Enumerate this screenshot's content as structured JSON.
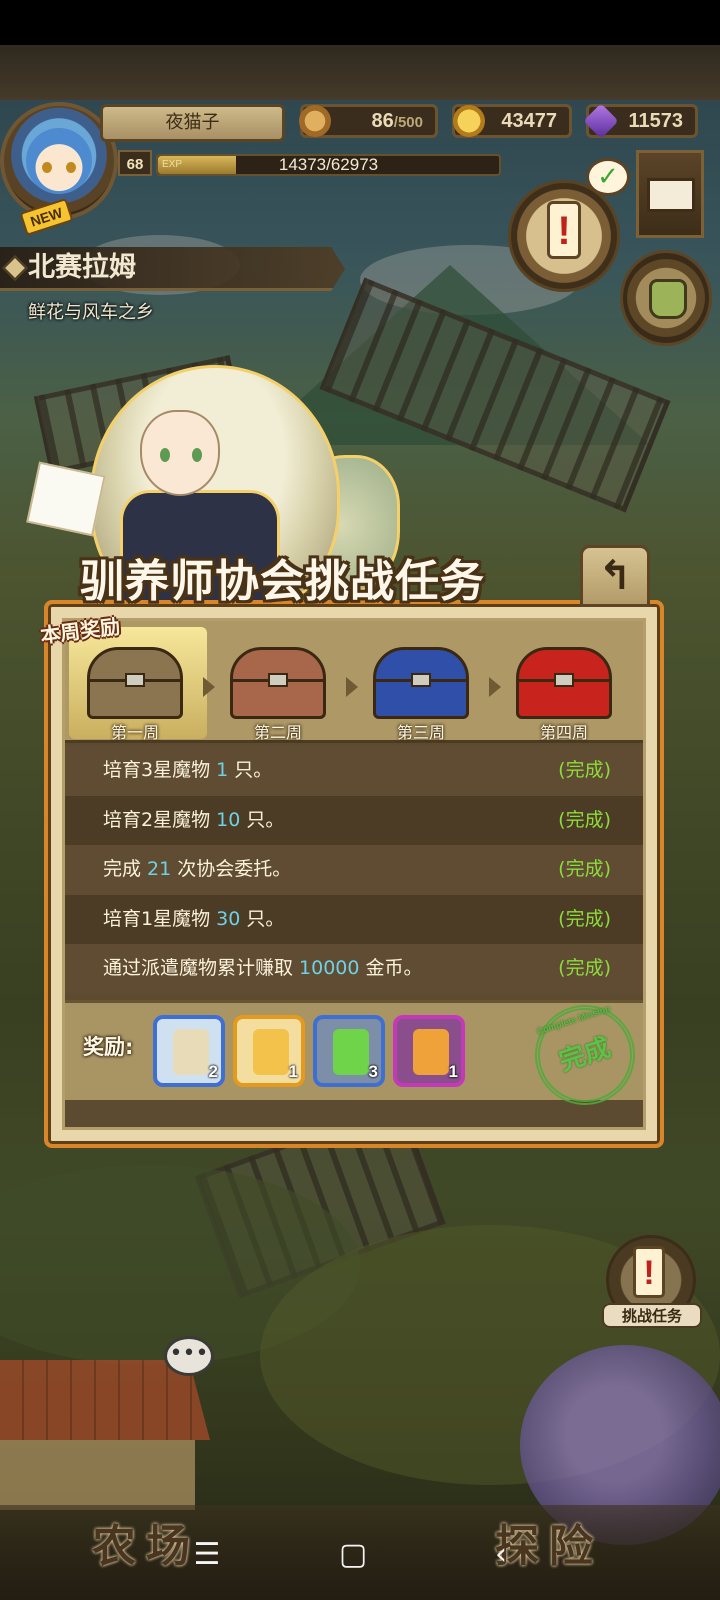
{
  "player": {
    "name": "夜猫子",
    "level": "68",
    "new_badge": "NEW",
    "exp_label": "EXP",
    "exp_text": "14373/62973",
    "exp_fraction": 0.228
  },
  "resources": {
    "stamina_value": "86",
    "stamina_max": "/500",
    "gold": "43477",
    "gems": "11573"
  },
  "location": {
    "title": "北赛拉姆",
    "subtitle": "鲜花与风车之乡"
  },
  "quest": {
    "title": "驯养师协会挑战任务",
    "back_icon": "return-arrow-icon",
    "back_glyph": "↰",
    "week_banner": "本周奖励",
    "weeks": [
      {
        "label": "第一周",
        "chest_color": "#8a7550"
      },
      {
        "label": "第二周",
        "chest_color": "#a8674a"
      },
      {
        "label": "第三周",
        "chest_color": "#2f4fa8"
      },
      {
        "label": "第四周",
        "chest_color": "#c8231c"
      }
    ],
    "tasks": [
      {
        "pre": "培育3星魔物 ",
        "num": "1",
        "post": " 只。",
        "status": "(完成)"
      },
      {
        "pre": "培育2星魔物 ",
        "num": "10",
        "post": " 只。",
        "status": "(完成)"
      },
      {
        "pre": "完成 ",
        "num": "21",
        "post": " 次协会委托。",
        "status": "(完成)"
      },
      {
        "pre": "培育1星魔物 ",
        "num": "30",
        "post": " 只。",
        "status": "(完成)"
      },
      {
        "pre": "通过派遣魔物累计赚取 ",
        "num": "10000",
        "post": " 金币。",
        "status": "(完成)"
      }
    ],
    "reward_label": "奖励:",
    "rewards": [
      {
        "icon": "scroll-icon",
        "count": "2",
        "border": "#3f6fd0",
        "bg": "#cfe0f0",
        "fill": "#e8dcb8"
      },
      {
        "icon": "potion-icon",
        "count": "1",
        "border": "#e39a1e",
        "bg": "#f3dea0",
        "fill": "#f2c24a"
      },
      {
        "icon": "green-tank-icon",
        "count": "3",
        "border": "#3f6fd0",
        "bg": "#7d8ea8",
        "fill": "#6fd44a"
      },
      {
        "icon": "rainbow-tank-icon",
        "count": "1",
        "border": "#c23ab8",
        "bg": "#8a4e8c",
        "fill": "#f0a23a"
      }
    ],
    "stamp_text": "完成",
    "stamp_ring": "Complete Mission"
  },
  "side": {
    "challenge_label": "挑战任务",
    "chat_icon": "chat-bubble-icon"
  },
  "nav": {
    "farm": "农场",
    "explore": "探险",
    "sys_menu": "☰",
    "sys_home": "▢",
    "sys_back": "‹"
  },
  "colors": {
    "task_number": "#6fd1e6",
    "task_status": "#8ddc3c",
    "panel_border": "#d9862a"
  }
}
